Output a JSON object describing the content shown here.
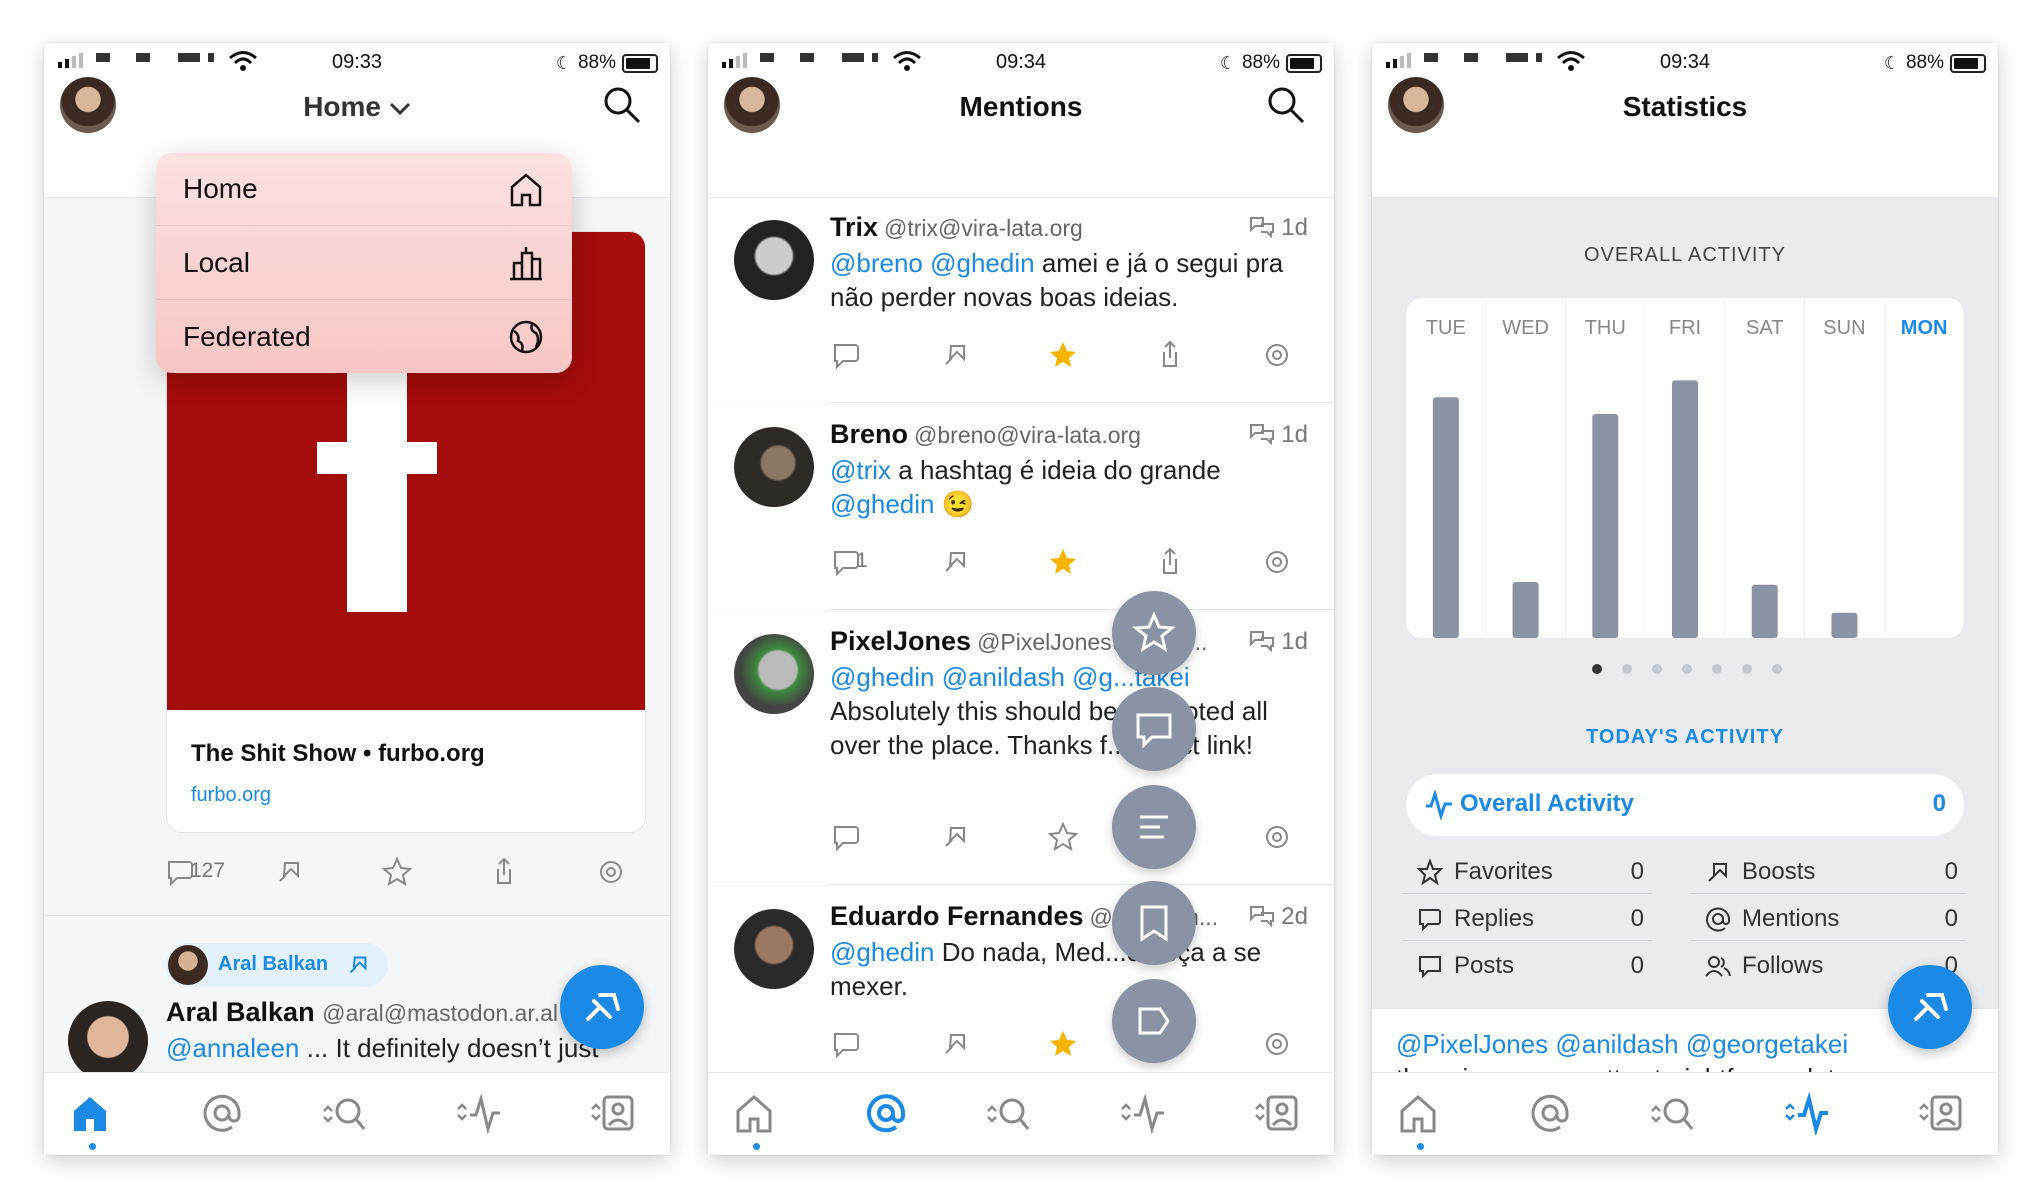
{
  "status": [
    {
      "time": "09:33",
      "battery": "88%"
    },
    {
      "time": "09:34",
      "battery": "88%"
    },
    {
      "time": "09:34",
      "battery": "88%"
    }
  ],
  "phone1": {
    "title": "Home",
    "menu": [
      {
        "label": "Home",
        "icon": "home-icon"
      },
      {
        "label": "Local",
        "icon": "city-icon"
      },
      {
        "label": "Federated",
        "icon": "globe-icon"
      }
    ],
    "card": {
      "title": "The Shit Show • furbo.org",
      "link": "furbo.org"
    },
    "reply_count": "127",
    "boosted_by": "Aral Balkan",
    "post": {
      "name": "Aral Balkan",
      "handle": "@aral@mastodon.ar.al",
      "mention": "@annaleen",
      "text": " ... It definitely doesn’t just"
    }
  },
  "phone2": {
    "title": "Mentions",
    "posts": [
      {
        "name": "Trix",
        "handle": "@trix@vira-lata.org",
        "time": "1d",
        "mentions": "@breno @ghedin",
        "text": " amei e já o segui pra não perder novas boas ideias.",
        "replies": ""
      },
      {
        "name": "Breno",
        "handle": "@breno@vira-lata.org",
        "time": "1d",
        "mentions": "@trix",
        "text": " a hashtag é ideia do grande ",
        "mentions2": "@ghedin",
        "emoji": "😉",
        "replies": "1"
      },
      {
        "name": "PixelJones",
        "handle": "@PixelJones@...dly....",
        "time": "1d",
        "mentions": "@ghedin @anildash @g...takei",
        "text": " Absolutely this should be promoted all over the place. Thanks f... direct link!",
        "replies": ""
      },
      {
        "name": "Eduardo Fernandes",
        "handle": "@eduf@in...",
        "time": "2d",
        "mentions": "@ghedin",
        "text": " Do nada, Med...omeça a se mexer.",
        "replies": ""
      }
    ]
  },
  "phone3": {
    "title": "Statistics",
    "overall_title": "OVERALL ACTIVITY",
    "days": [
      "TUE",
      "WED",
      "THU",
      "FRI",
      "SAT",
      "SUN",
      "MON"
    ],
    "today_title": "TODAY'S ACTIVITY",
    "overall_label": "Overall Activity",
    "overall_value": "0",
    "stats": [
      {
        "label": "Favorites",
        "value": "0",
        "icon": "star-icon"
      },
      {
        "label": "Boosts",
        "value": "0",
        "icon": "boost-icon"
      },
      {
        "label": "Replies",
        "value": "0",
        "icon": "reply-icon"
      },
      {
        "label": "Mentions",
        "value": "0",
        "icon": "at-icon"
      },
      {
        "label": "Posts",
        "value": "0",
        "icon": "post-icon"
      },
      {
        "label": "Follows",
        "value": "0",
        "icon": "follows-icon"
      }
    ],
    "post": {
      "mentions": "@PixelJones @anildash @georgetakei",
      "text": "there is a way, pretty straightforward, to"
    }
  },
  "chart_data": {
    "type": "bar",
    "categories": [
      "TUE",
      "WED",
      "THU",
      "FRI",
      "SAT",
      "SUN",
      "MON"
    ],
    "values": [
      0.86,
      0.2,
      0.8,
      0.92,
      0.19,
      0.09,
      0
    ],
    "title": "OVERALL ACTIVITY",
    "xlabel": "",
    "ylabel": "",
    "ylim": [
      0,
      1
    ],
    "highlight_category": "MON",
    "colors": {
      "bar": "#8a93a3",
      "highlight": "#1a8ae6"
    }
  },
  "colors": {
    "accent": "#1a8ae6",
    "favorite": "#f7b500",
    "card_red": "#a50c0c"
  }
}
